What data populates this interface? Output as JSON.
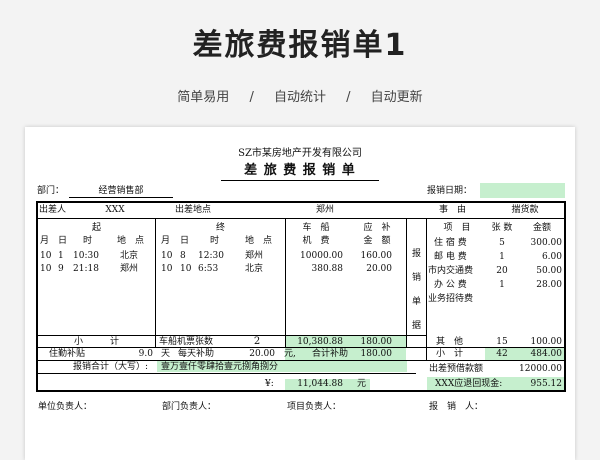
{
  "page": {
    "title": "差旅费报销单1",
    "features": [
      "简单易用",
      "自动统计",
      "自动更新"
    ],
    "separator": "/"
  },
  "form": {
    "company": "SZ市某房地产开发有限公司",
    "heading": "差 旅 费 报 销 单",
    "dept_label": "部门：",
    "dept_value": "经营销售部",
    "date_label": "报销日期：",
    "traveler_label": "出差人",
    "traveler_value": "XXX",
    "place_label": "出差地点",
    "place_value": "郑州",
    "reason_label": "事　由",
    "reason_value": "揣货款",
    "departure_label": "起",
    "arrival_label": "终",
    "fare_label": [
      "车　船",
      "机　费"
    ],
    "allowance_label": [
      "应　补",
      "金　额"
    ],
    "date_cols": [
      "月",
      "日",
      "时",
      "地　点"
    ],
    "trips": [
      {
        "dep": [
          "10",
          "1",
          "10:30",
          "北京"
        ],
        "arr": [
          "10",
          "8",
          "12:30",
          "郑州"
        ],
        "fare": "10000.00",
        "allow": "160.00"
      },
      {
        "dep": [
          "10",
          "9",
          "21:18",
          "郑州"
        ],
        "arr": [
          "10",
          "10",
          "6:53",
          "北京"
        ],
        "fare": "380.88",
        "allow": "20.00"
      }
    ],
    "receipts_vertical": [
      "报",
      "销",
      "单",
      "据"
    ],
    "items_header": [
      "项　目",
      "张 数",
      "金额"
    ],
    "items": [
      {
        "name": "住 宿 费",
        "count": "5",
        "amount": "300.00"
      },
      {
        "name": "邮 电 费",
        "count": "1",
        "amount": "6.00"
      },
      {
        "name": "市内交通费",
        "count": "20",
        "amount": "50.00"
      },
      {
        "name": "办 公 费",
        "count": "1",
        "amount": "28.00"
      },
      {
        "name": "业务招待费",
        "count": "",
        "amount": ""
      }
    ],
    "subtotal_label": "小　　　计",
    "ticket_count_label": "车船机票张数",
    "ticket_count": "2",
    "fare_total": "10,380.88",
    "allow_total": "180.00",
    "other_label": "其　他",
    "other_count": "15",
    "other_amount": "100.00",
    "sub2_label": "小　计",
    "sub2_count": "42",
    "sub2_amount": "484.00",
    "stay_label": "住勤补贴",
    "stay_days": "9.0",
    "day_unit": "天",
    "per_day_label": "每天补助",
    "per_day": "20.00",
    "yuan_comma": "元,",
    "total_allow_label": "合计补助",
    "total_allow": "180.00",
    "advance_label": "出差预借款额",
    "advance": "12000.00",
    "total_label": "报销合计（大写）:",
    "total_upper": "壹万壹仟零肆拾壹元捌角捌分",
    "yen_label": "¥:",
    "total_num": "11,044.88",
    "yuan": "元",
    "refund_label": "XXX应退回现金:",
    "refund": "955.12",
    "signers": [
      "单位负责人：",
      "部门负责人：",
      "项目负责人：",
      "报　销　人："
    ]
  }
}
